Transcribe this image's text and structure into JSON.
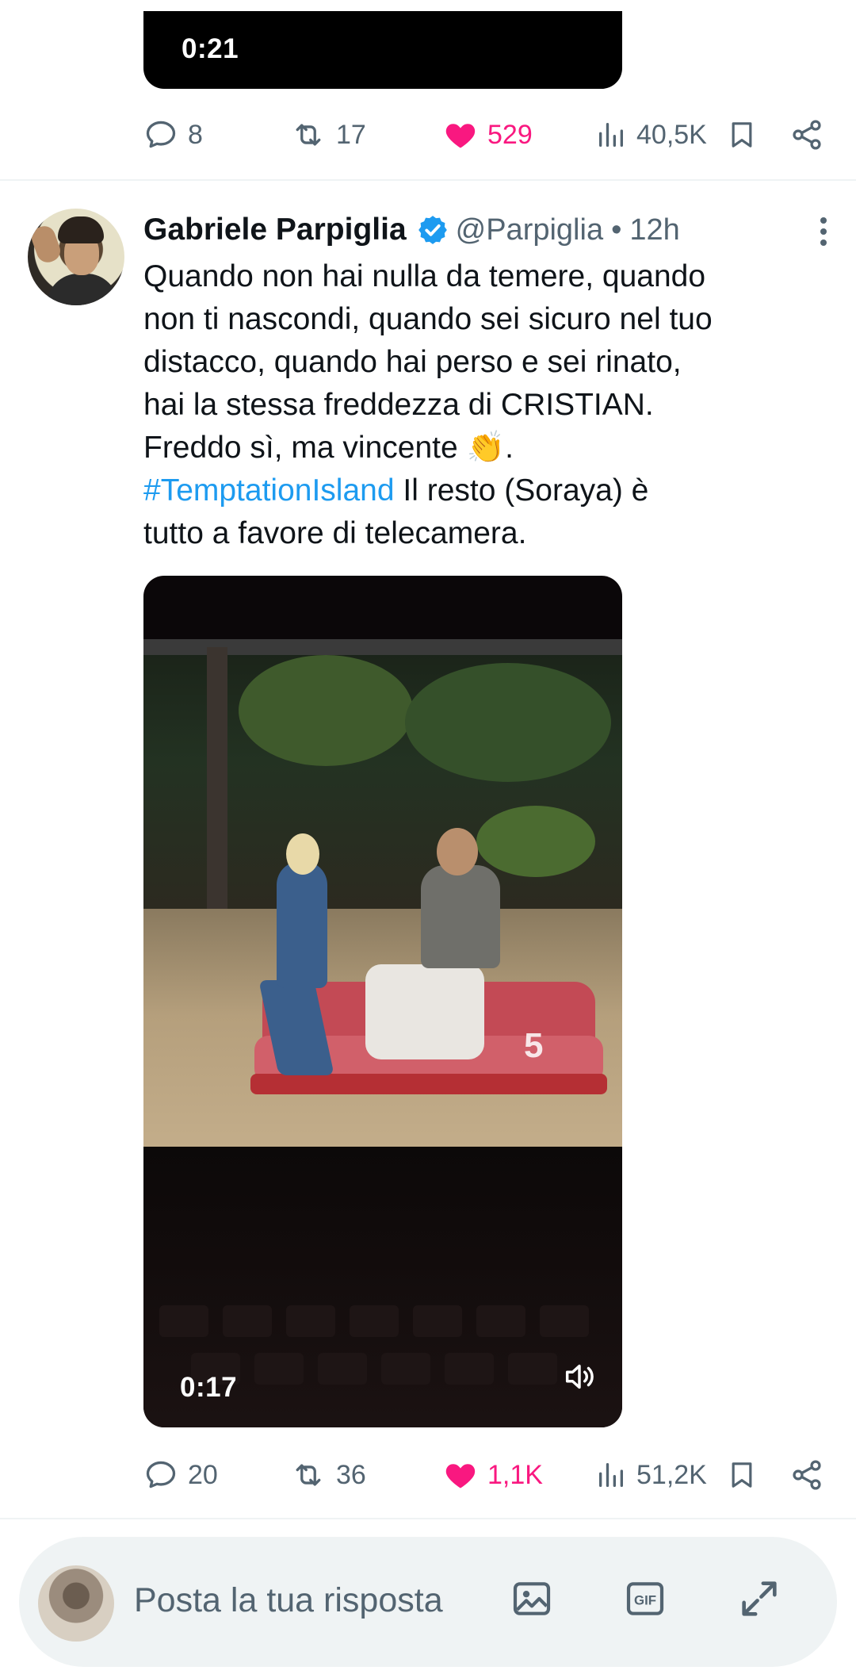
{
  "previous_tweet": {
    "video_time": "0:21",
    "actions": {
      "replies": "8",
      "reposts": "17",
      "likes": "529",
      "views": "40,5K"
    }
  },
  "tweet": {
    "author_name": "Gabriele Parpiglia",
    "handle": "@Parpiglia",
    "separator": "•",
    "time": "12h",
    "text_lines": [
      "Quando non hai nulla da temere, quando",
      "non ti nascondi, quando sei sicuro nel tuo",
      "distacco, quando hai perso e sei rinato,",
      "hai la stessa freddezza di CRISTIAN.",
      "Freddo sì, ma vincente 👏.",
      "Il resto (Soraya) è",
      "tutto a favore di telecamera."
    ],
    "hashtag": "#TemptationIsland",
    "media": {
      "video_time": "0:17",
      "channel_logo": "5"
    },
    "actions": {
      "replies": "20",
      "reposts": "36",
      "likes": "1,1K",
      "views": "51,2K"
    }
  },
  "compose": {
    "placeholder": "Posta la tua risposta"
  },
  "colors": {
    "like": "#f91880",
    "link": "#1d9bf0",
    "verified": "#1d9bf0",
    "secondary_text": "#536471"
  },
  "icons": [
    "reply-icon",
    "repost-icon",
    "heart-icon",
    "views-icon",
    "bookmark-icon",
    "share-icon",
    "verified-badge-icon",
    "more-icon",
    "volume-icon",
    "image-icon",
    "gif-icon",
    "expand-icon"
  ]
}
